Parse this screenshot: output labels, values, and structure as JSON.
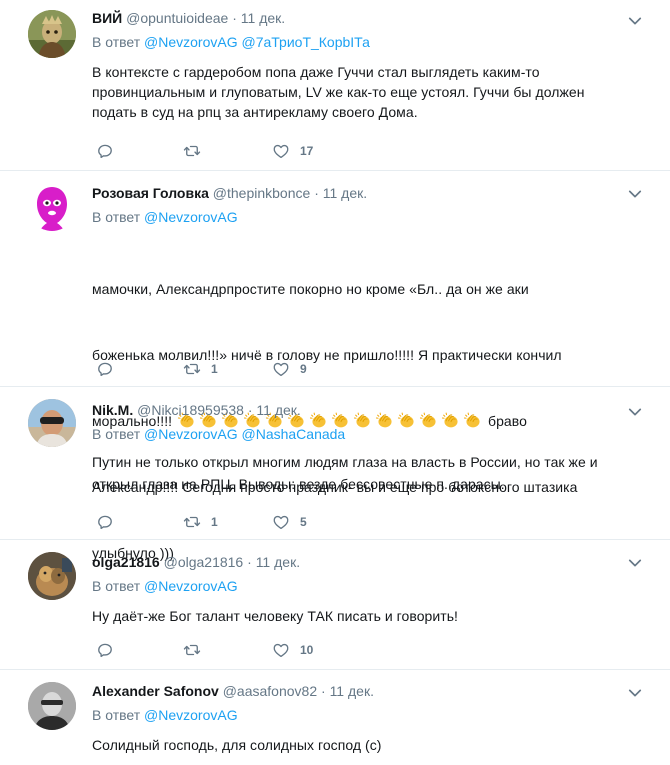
{
  "tweets": [
    {
      "name": "ВИЙ",
      "handle": "@opuntuioideae",
      "dot": "·",
      "time": "11 дек.",
      "reply_prefix": "В ответ",
      "reply_to": [
        "@NevzorovAG",
        "@7аТриоТ_КорbIТа"
      ],
      "text": "В контексте с гардеробом попа даже Гуччи стал выглядеть каким-то\nпровинциальным и глуповатым, LV же как-то еще устоял. Гуччи бы должен\nподать в суд на рпц за антирекламу своего Дома.",
      "replies": "",
      "retweets": "",
      "likes": "17"
    },
    {
      "name": "Розовая Головка",
      "handle": "@thepinkbonce",
      "dot": "·",
      "time": "11 дек.",
      "reply_prefix": "В ответ",
      "reply_to": [
        "@NevzorovAG"
      ],
      "text_line1": "мамочки, Александрпростите покорно но кроме «Бл.. да он же аки",
      "text_line2": "боженька молвил!!!» ничё в голову не пришло!!!!! Я практически кончил",
      "text_line3_pre": "морально!!!! ",
      "text_line3_post": " браво",
      "text_line4": "Александр!!!! Сегодня просто праздник- вы и еще про ботоксного штазика",
      "text_line5": "улыбнуло )))",
      "replies": "",
      "retweets": "1",
      "likes": "9"
    },
    {
      "name": "Nik.M.",
      "handle": "@Nikci18959538",
      "dot": "·",
      "time": "11 дек.",
      "reply_prefix": "В ответ",
      "reply_to": [
        "@NevzorovAG",
        "@NashaCanada"
      ],
      "text": "Путин не только открыл многим людям глаза на власть в России, но так же и\nоткрыл глаза на РПЦ. Выводы: везде бессовестные п..дарасы.",
      "replies": "",
      "retweets": "1",
      "likes": "5"
    },
    {
      "name": "olga21816",
      "handle": "@olga21816",
      "dot": "·",
      "time": "11 дек.",
      "reply_prefix": "В ответ",
      "reply_to": [
        "@NevzorovAG"
      ],
      "text": "Ну даёт-же Бог талант человеку ТАК писать и говорить!",
      "replies": "",
      "retweets": "",
      "likes": "10"
    },
    {
      "name": "Alexander Safonov",
      "handle": "@aasafonov82",
      "dot": "·",
      "time": "11 дек.",
      "reply_prefix": "В ответ",
      "reply_to": [
        "@NevzorovAG"
      ],
      "text": "Солидный господь, для солидных господ (с)"
    }
  ],
  "colors": {
    "link": "#1da1f2",
    "muted": "#657786",
    "text": "#14171a",
    "divider": "#e6ecf0"
  },
  "icons": [
    "reply-icon",
    "retweet-icon",
    "like-icon",
    "caret-down-icon",
    "clapping-hands-emoji"
  ]
}
